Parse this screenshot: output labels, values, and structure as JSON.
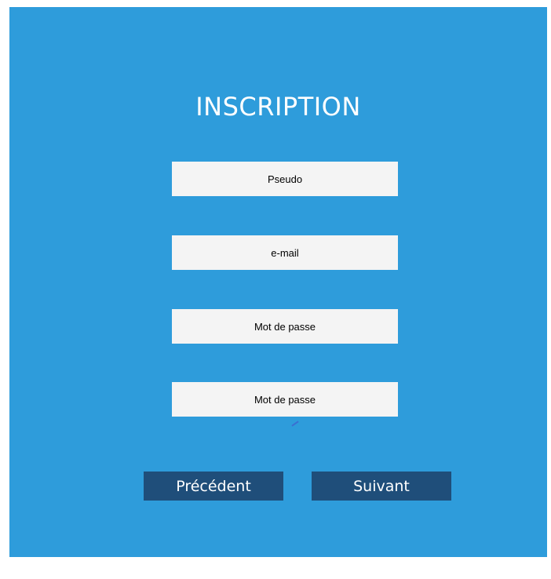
{
  "form": {
    "title": "INSCRIPTION",
    "fields": [
      {
        "placeholder": "Pseudo",
        "value": ""
      },
      {
        "placeholder": "e-mail",
        "value": ""
      },
      {
        "placeholder": "Mot de passe",
        "value": ""
      },
      {
        "placeholder": "Mot de passe",
        "value": ""
      }
    ],
    "buttons": {
      "previous": "Précédent",
      "next": "Suivant"
    }
  },
  "colors": {
    "background": "#2E9CDB",
    "field": "#F4F4F4",
    "button": "#1F4E7A",
    "text_light": "#FFFFFF"
  }
}
